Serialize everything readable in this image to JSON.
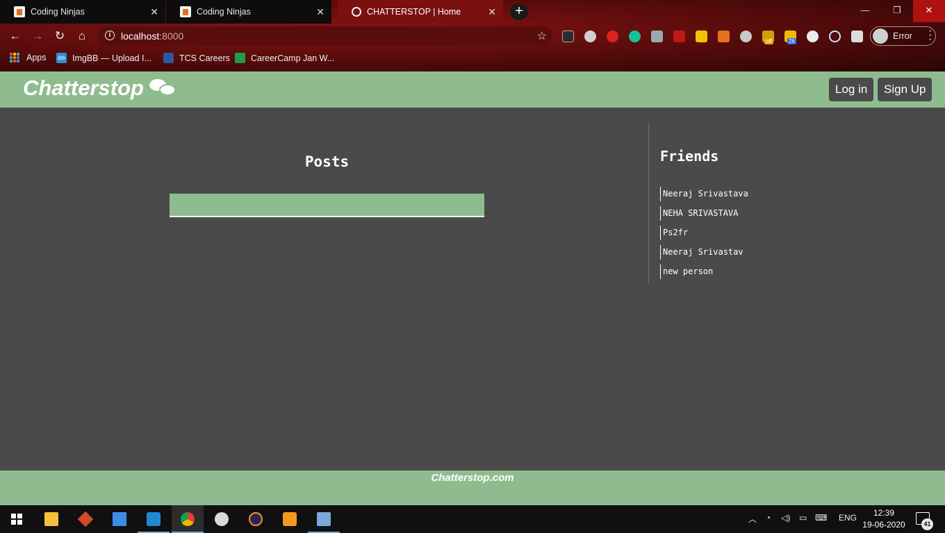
{
  "browser": {
    "tabs": [
      {
        "title": "Coding Ninjas",
        "icon": "coding-ninjas-favicon"
      },
      {
        "title": "Coding Ninjas",
        "icon": "coding-ninjas-favicon"
      },
      {
        "title": "CHATTERSTOP | Home",
        "icon": "globe-icon",
        "active": true
      }
    ],
    "new_tab": "+",
    "window_controls": {
      "minimize": "—",
      "restore": "❐",
      "close": "✕"
    },
    "nav": {
      "back": "←",
      "forward": "→",
      "reload": "↻",
      "home": "⌂"
    },
    "address": {
      "host": "localhost",
      "port": ":8000"
    },
    "bookmark_star": "☆",
    "profile_status": "Error",
    "bookmarks": [
      {
        "label": "Apps",
        "icon": "apps-grid-icon"
      },
      {
        "label": "ImgBB — Upload I...",
        "icon": "imgbb-icon",
        "badge": "ibb"
      },
      {
        "label": "TCS Careers",
        "icon": "tata-icon"
      },
      {
        "label": "CareerCamp Jan W...",
        "icon": "careercamp-icon"
      }
    ],
    "extension_badges": {
      "off": "off",
      "count": "26"
    }
  },
  "site": {
    "brand": "Chatterstop",
    "brand_icon": "chat-bubbles-icon",
    "login_label": "Log in",
    "signup_label": "Sign Up",
    "posts_heading": "Posts",
    "friends_heading": "Friends",
    "friends": [
      "Neeraj Srivastava",
      "NEHA SRIVASTAVA",
      "Ps2fr",
      "Neeraj Srivastav",
      "new person"
    ],
    "footer": "Chatterstop.com",
    "colors": {
      "accent_green": "#8fbc8f",
      "background_gray": "#4a4a4a"
    }
  },
  "taskbar": {
    "language": "ENG",
    "time": "12:39",
    "date": "19-06-2020",
    "notifications": "41"
  }
}
